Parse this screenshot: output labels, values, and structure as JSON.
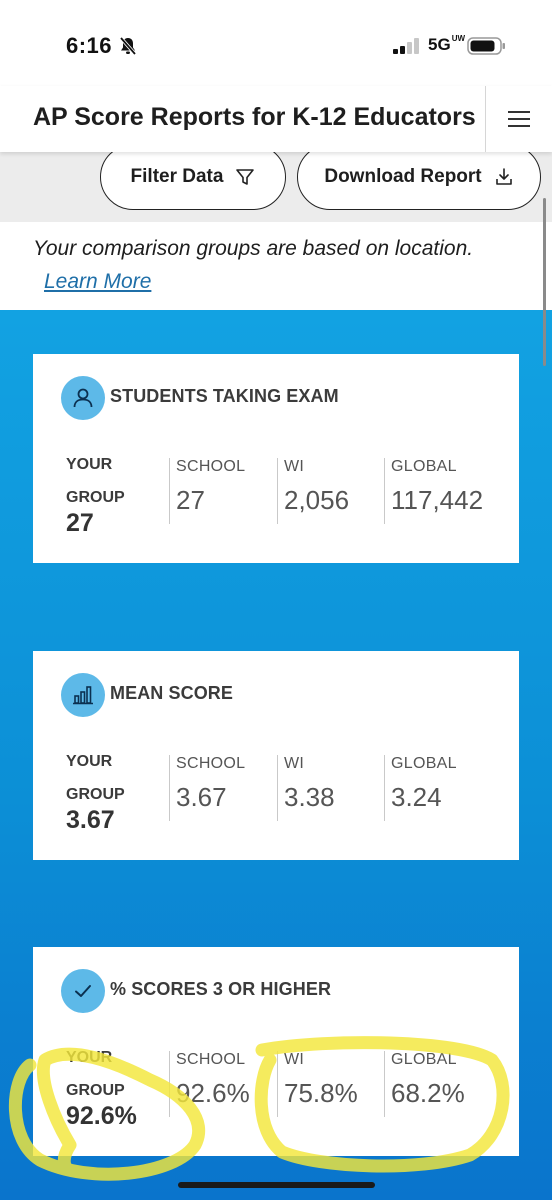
{
  "status_bar": {
    "time": "6:16",
    "network": "5G",
    "network_sup": "UW"
  },
  "header": {
    "title": "AP Score Reports for K-12 Educators"
  },
  "toolbar": {
    "filter_label": "Filter Data",
    "download_label": "Download Report"
  },
  "info": {
    "text": "Your comparison groups are based on location.",
    "link": "Learn More"
  },
  "labels": {
    "your": "YOUR",
    "group": "GROUP",
    "school": "SCHOOL",
    "state": "WI",
    "global": "GLOBAL"
  },
  "cards": [
    {
      "title": "STUDENTS TAKING EXAM",
      "icon": "person-icon",
      "your_group": "27",
      "school": "27",
      "state": "2,056",
      "global": "117,442"
    },
    {
      "title": "MEAN SCORE",
      "icon": "bar-chart-icon",
      "your_group": "3.67",
      "school": "3.67",
      "state": "3.38",
      "global": "3.24"
    },
    {
      "title": "% SCORES 3 OR HIGHER",
      "icon": "checkmark-icon",
      "your_group": "92.6%",
      "school": "92.6%",
      "state": "75.8%",
      "global": "68.2%"
    }
  ],
  "colors": {
    "accent_blue": "#12a2e2",
    "icon_circle": "#5db9e8",
    "link": "#1f6fa8",
    "highlighter": "#f3e63a"
  }
}
